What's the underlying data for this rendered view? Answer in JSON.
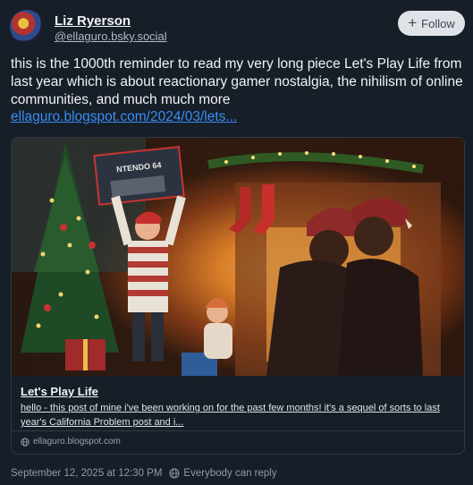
{
  "author": {
    "name": "Liz Ryerson",
    "handle": "@ellaguro.bsky.social"
  },
  "follow_button": {
    "label": "Follow",
    "icon": "plus-icon"
  },
  "post": {
    "text": "this is the 1000th reminder to read my very long piece Let's Play Life from last year which is about reactionary gamer nostalgia, the nihilism of online communities, and much much more",
    "link_text": "ellaguro.blogspot.com/2024/03/lets..."
  },
  "link_card": {
    "title": "Let's Play Life",
    "description": "hello - this post of mine i've been working on for the past few months! it's a sequel of sorts to last year's California Problem  post and i...",
    "domain": "ellaguro.blogspot.com",
    "domain_icon": "globe-icon",
    "image_box_text": "NTENDO 64"
  },
  "footer": {
    "timestamp": "September 12, 2025 at 12:30 PM",
    "reply_setting": "Everybody can reply",
    "reply_icon": "globe-icon"
  },
  "colors": {
    "background": "#161e27",
    "link": "#3b8cf5",
    "follow_bg": "#dfe3e8",
    "muted_text": "#8e9cab"
  }
}
